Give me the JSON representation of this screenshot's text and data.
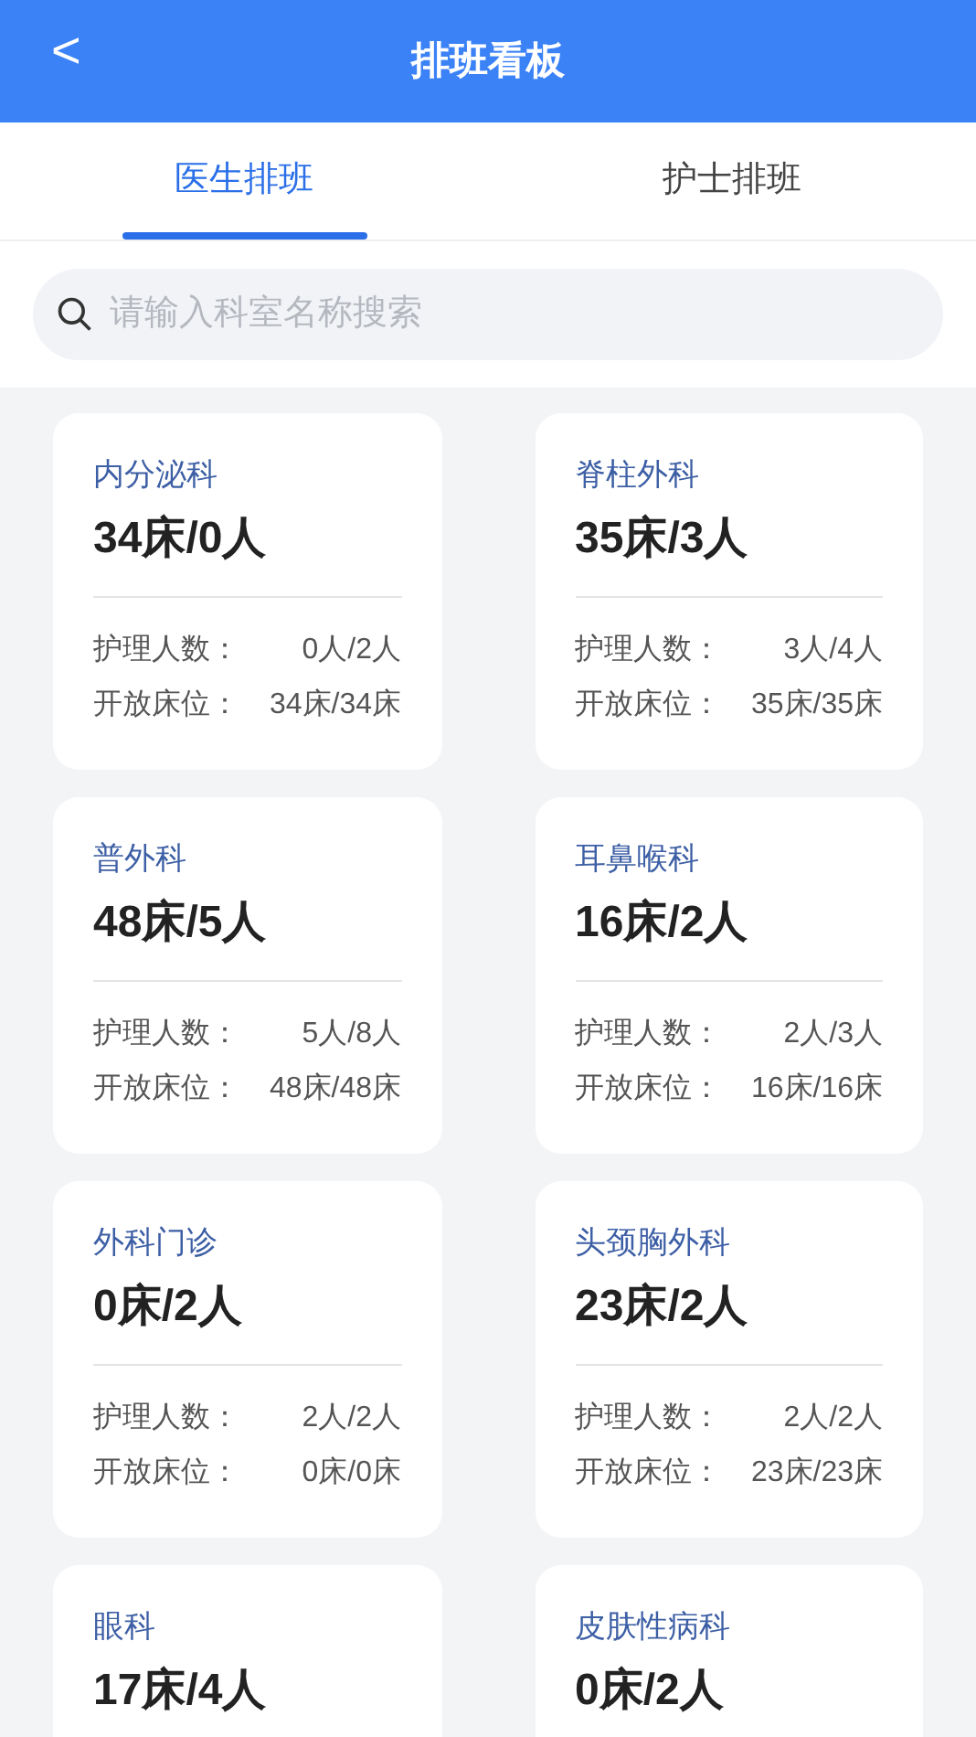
{
  "header": {
    "back_icon": "<",
    "title": "排班看板"
  },
  "tabs": [
    {
      "label": "医生排班",
      "selected": true
    },
    {
      "label": "护士排班",
      "selected": false
    }
  ],
  "search": {
    "placeholder": "请输入科室名称搜索"
  },
  "departments": [
    {
      "name": "内分泌科",
      "summary": "34床/0人",
      "stats": [
        {
          "label": "护理人数：",
          "value": "0人/2人"
        },
        {
          "label": "开放床位：",
          "value": "34床/34床"
        }
      ]
    },
    {
      "name": "脊柱外科",
      "summary": "35床/3人",
      "stats": [
        {
          "label": "护理人数：",
          "value": "3人/4人"
        },
        {
          "label": "开放床位：",
          "value": "35床/35床"
        }
      ]
    },
    {
      "name": "普外科",
      "summary": "48床/5人",
      "stats": [
        {
          "label": "护理人数：",
          "value": "5人/8人"
        },
        {
          "label": "开放床位：",
          "value": "48床/48床"
        }
      ]
    },
    {
      "name": "耳鼻喉科",
      "summary": "16床/2人",
      "stats": [
        {
          "label": "护理人数：",
          "value": "2人/3人"
        },
        {
          "label": "开放床位：",
          "value": "16床/16床"
        }
      ]
    },
    {
      "name": "外科门诊",
      "summary": "0床/2人",
      "stats": [
        {
          "label": "护理人数：",
          "value": "2人/2人"
        },
        {
          "label": "开放床位：",
          "value": "0床/0床"
        }
      ]
    },
    {
      "name": "头颈胸外科",
      "summary": "23床/2人",
      "stats": [
        {
          "label": "护理人数：",
          "value": "2人/2人"
        },
        {
          "label": "开放床位：",
          "value": "23床/23床"
        }
      ]
    },
    {
      "name": "眼科",
      "summary": "17床/4人"
    },
    {
      "name": "皮肤性病科",
      "summary": "0床/2人"
    }
  ]
}
